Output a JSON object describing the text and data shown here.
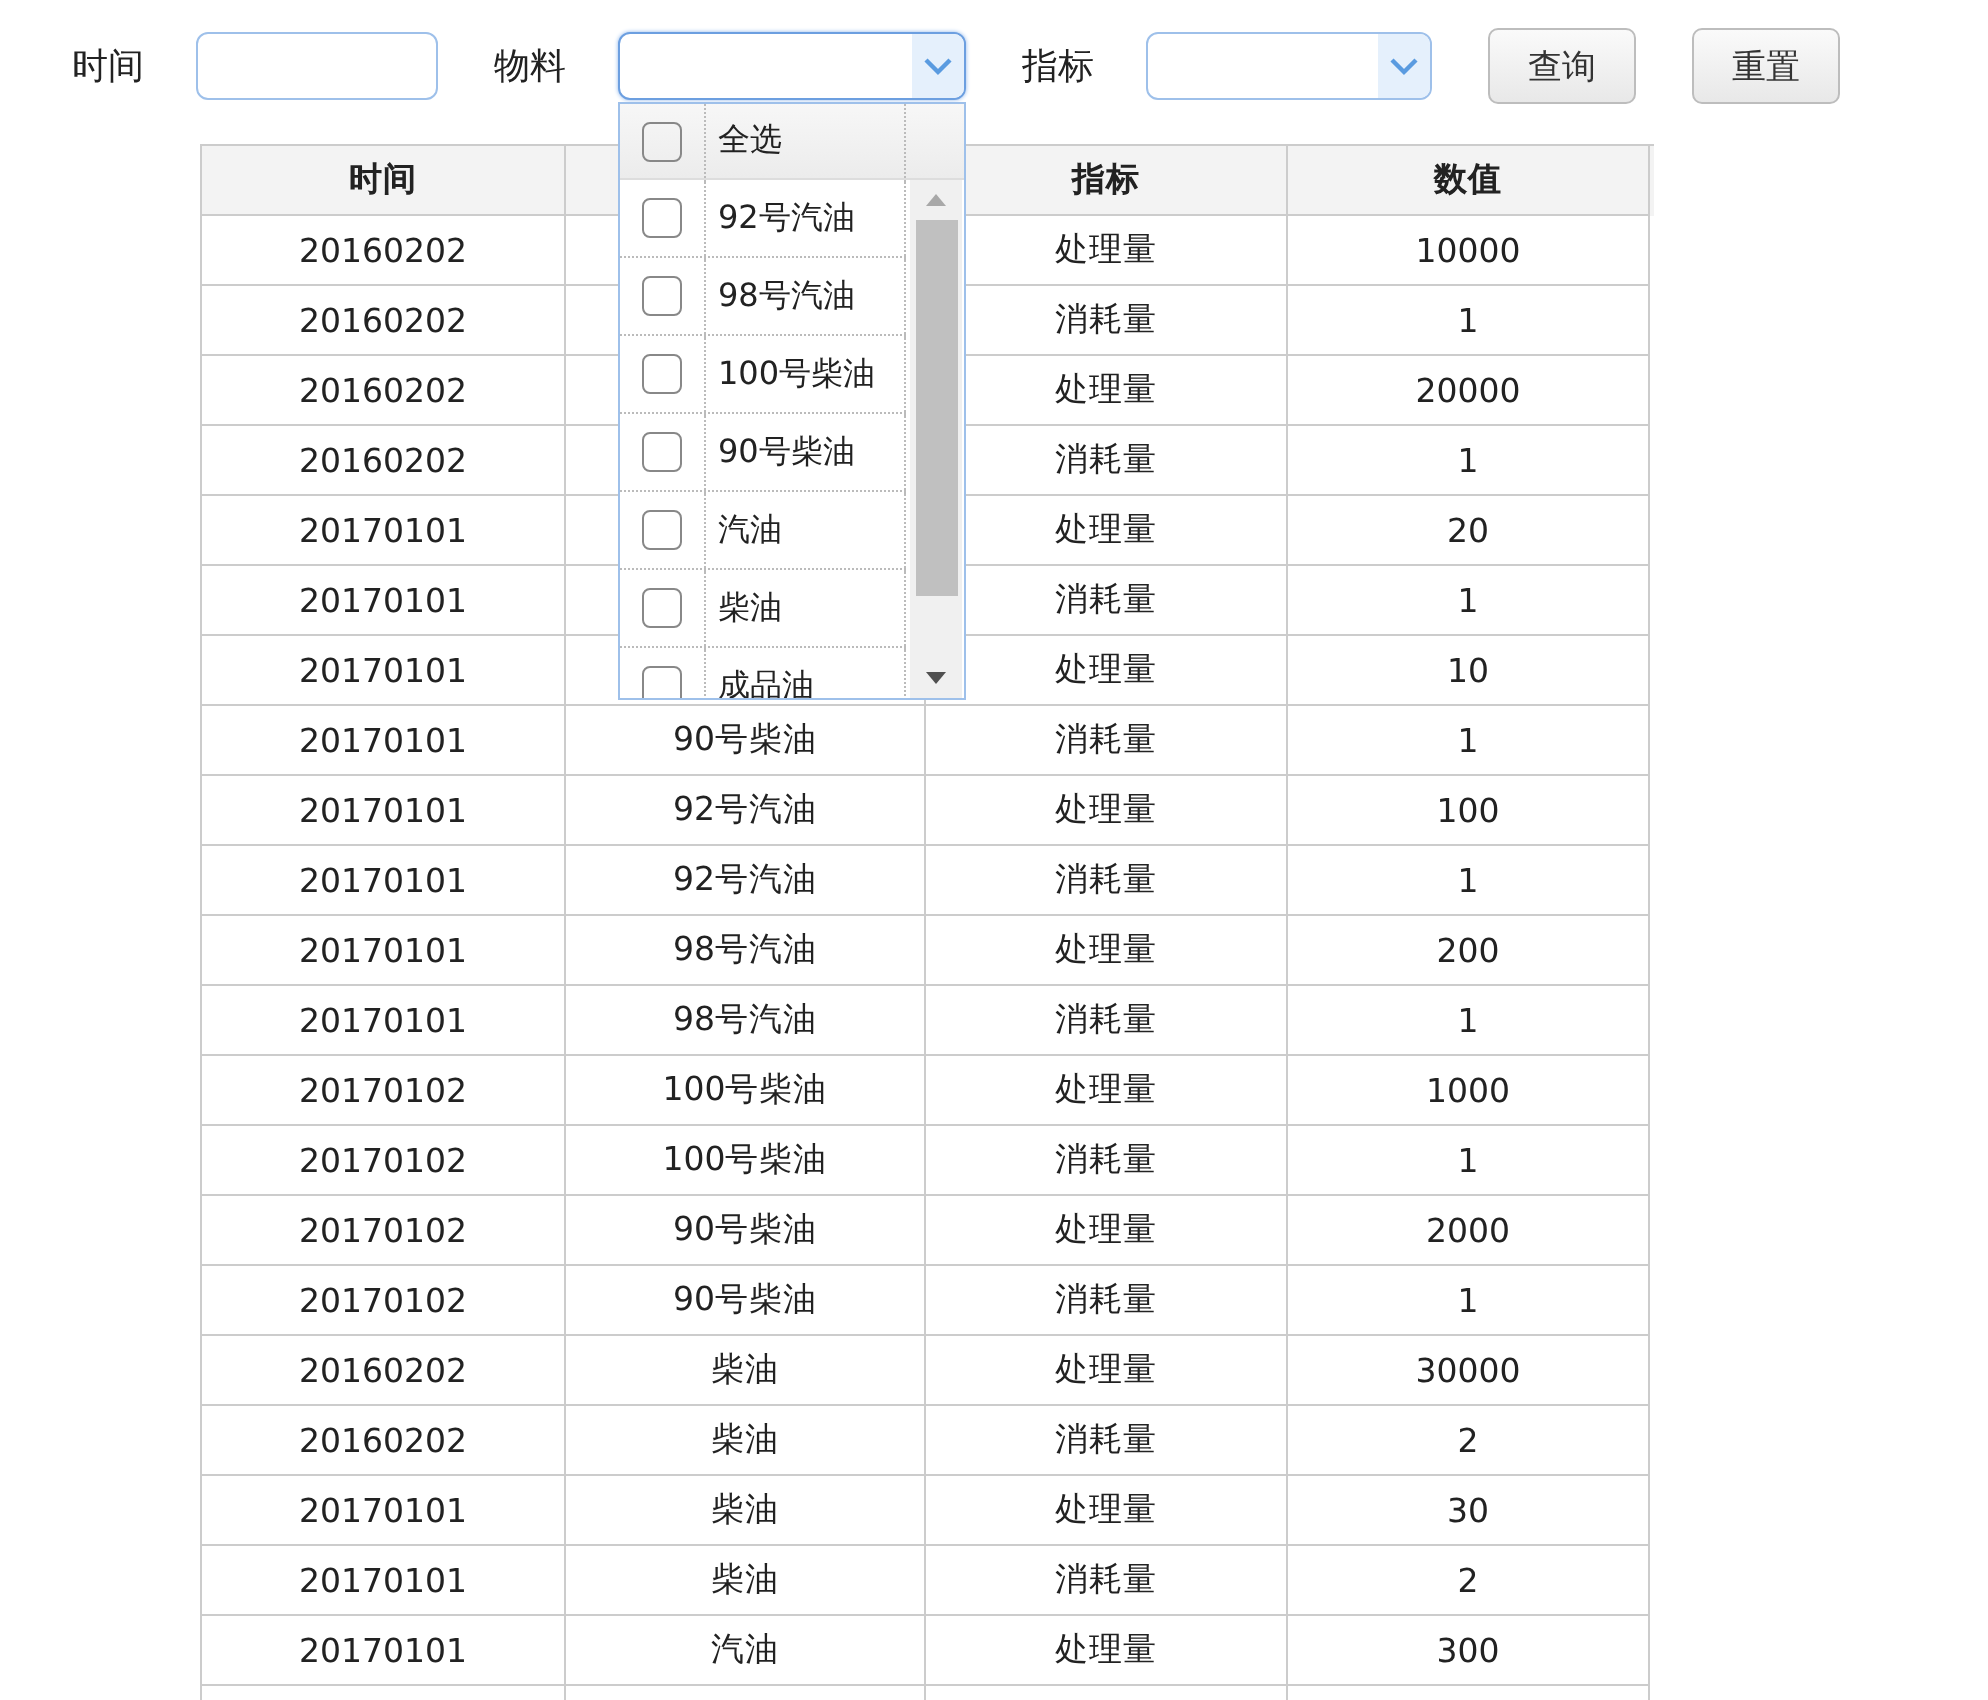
{
  "filters": [
    {
      "kind": "text",
      "label": "时间"
    },
    {
      "kind": "select",
      "label": "物料",
      "expanded": true
    },
    {
      "kind": "select",
      "label": "指标",
      "expanded": false
    }
  ],
  "buttons": [
    "查询",
    "重置"
  ],
  "dropdown": {
    "select_all": {
      "label": "全选",
      "checked": false
    },
    "options": [
      {
        "label": "92号汽油",
        "checked": false
      },
      {
        "label": "98号汽油",
        "checked": false
      },
      {
        "label": "100号柴油",
        "checked": false
      },
      {
        "label": "90号柴油",
        "checked": false
      },
      {
        "label": "汽油",
        "checked": false
      },
      {
        "label": "柴油",
        "checked": false
      },
      {
        "label": "成品油",
        "checked": false
      }
    ]
  },
  "table": {
    "columns": [
      {
        "label": "时间"
      },
      {},
      {
        "label": "指标"
      },
      {
        "label": "数值"
      }
    ],
    "rows": [
      {
        "time": "20160202",
        "metric": "处理量",
        "value": "10000"
      },
      {
        "time": "20160202",
        "metric": "消耗量",
        "value": "1"
      },
      {
        "time": "20160202",
        "metric": "处理量",
        "value": "20000"
      },
      {
        "time": "20160202",
        "metric": "消耗量",
        "value": "1"
      },
      {
        "time": "20170101",
        "metric": "处理量",
        "value": "20"
      },
      {
        "time": "20170101",
        "metric": "消耗量",
        "value": "1"
      },
      {
        "time": "20170101",
        "metric": "处理量",
        "value": "10"
      },
      {
        "time": "20170101",
        "material": "90号柴油",
        "metric": "消耗量",
        "value": "1"
      },
      {
        "time": "20170101",
        "material": "92号汽油",
        "metric": "处理量",
        "value": "100"
      },
      {
        "time": "20170101",
        "material": "92号汽油",
        "metric": "消耗量",
        "value": "1"
      },
      {
        "time": "20170101",
        "material": "98号汽油",
        "metric": "处理量",
        "value": "200"
      },
      {
        "time": "20170101",
        "material": "98号汽油",
        "metric": "消耗量",
        "value": "1"
      },
      {
        "time": "20170102",
        "material": "100号柴油",
        "metric": "处理量",
        "value": "1000"
      },
      {
        "time": "20170102",
        "material": "100号柴油",
        "metric": "消耗量",
        "value": "1"
      },
      {
        "time": "20170102",
        "material": "90号柴油",
        "metric": "处理量",
        "value": "2000"
      },
      {
        "time": "20170102",
        "material": "90号柴油",
        "metric": "消耗量",
        "value": "1"
      },
      {
        "time": "20160202",
        "material": "柴油",
        "metric": "处理量",
        "value": "30000"
      },
      {
        "time": "20160202",
        "material": "柴油",
        "metric": "消耗量",
        "value": "2"
      },
      {
        "time": "20170101",
        "material": "柴油",
        "metric": "处理量",
        "value": "30"
      },
      {
        "time": "20170101",
        "material": "柴油",
        "metric": "消耗量",
        "value": "2"
      },
      {
        "time": "20170101",
        "material": "汽油",
        "metric": "处理量",
        "value": "300"
      }
    ]
  }
}
